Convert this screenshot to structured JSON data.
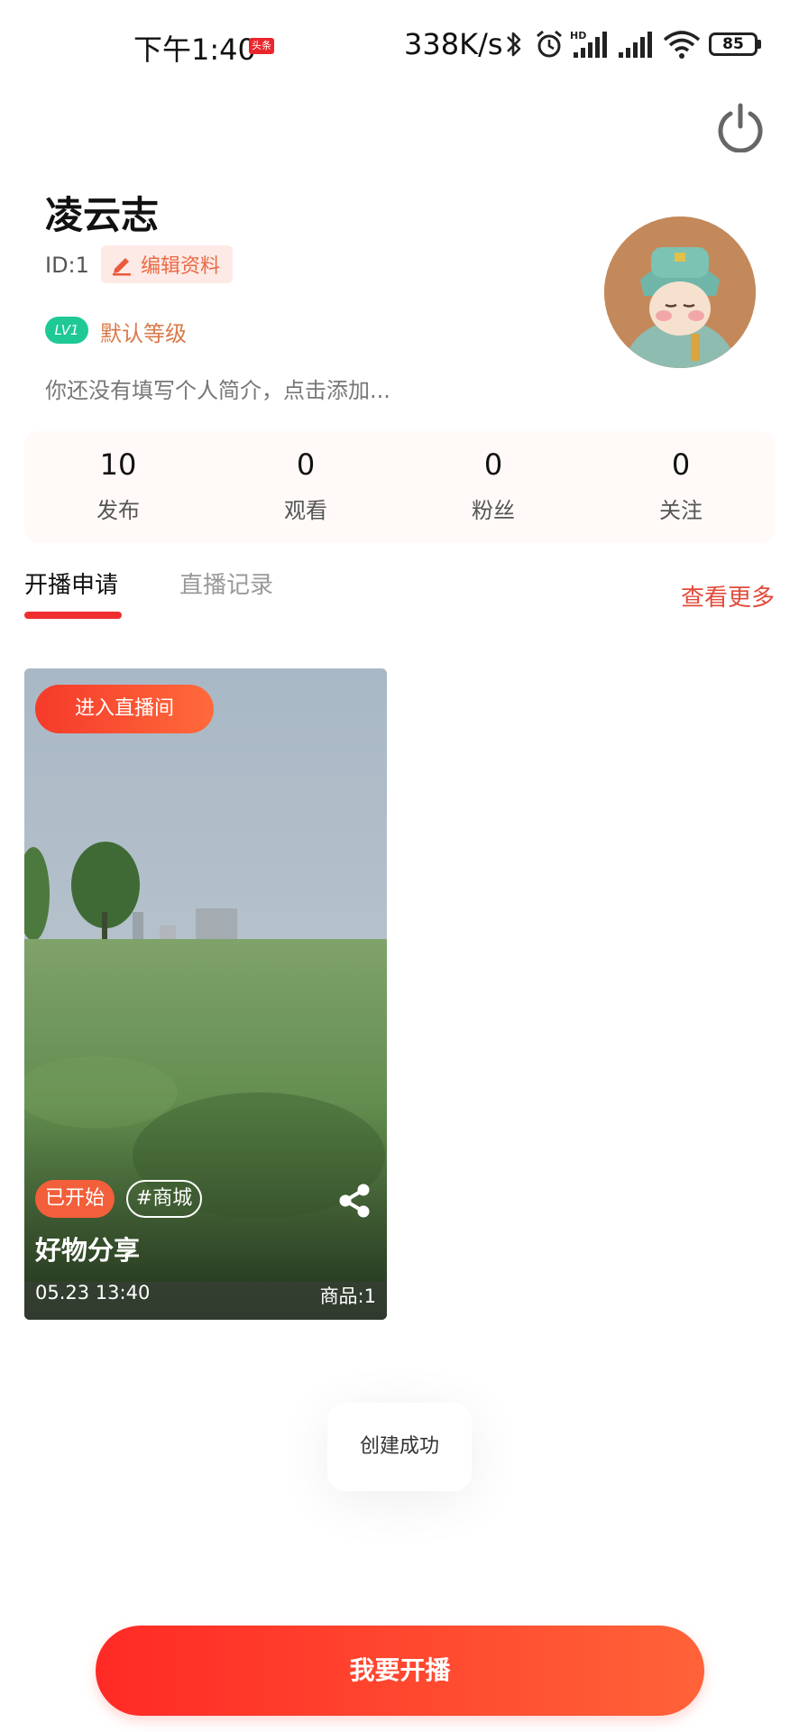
{
  "status_bar": {
    "time": "下午1:40",
    "app_badge": "头条",
    "net_speed": "338K/s",
    "battery": "85"
  },
  "profile": {
    "name": "凌云志",
    "id_label": "ID:1",
    "edit_label": "编辑资料",
    "level_badge": "LV1",
    "level_name": "默认等级",
    "bio": "你还没有填写个人简介，点击添加..."
  },
  "stats": [
    {
      "value": "10",
      "label": "发布"
    },
    {
      "value": "0",
      "label": "观看"
    },
    {
      "value": "0",
      "label": "粉丝"
    },
    {
      "value": "0",
      "label": "关注"
    }
  ],
  "tabs": {
    "items": [
      {
        "label": "开播申请"
      },
      {
        "label": "直播记录"
      }
    ],
    "see_more": "查看更多"
  },
  "card": {
    "enter_label": "进入直播间",
    "status": "已开始",
    "tag": "#商城",
    "title": "好物分享",
    "date": "05.23 13:40",
    "goods": "商品:1"
  },
  "toast": "创建成功",
  "go_live_label": "我要开播",
  "colors": {
    "accent": "#ef2f2f",
    "accent_orange": "#ff6a3b",
    "level_green": "#1ec996"
  }
}
